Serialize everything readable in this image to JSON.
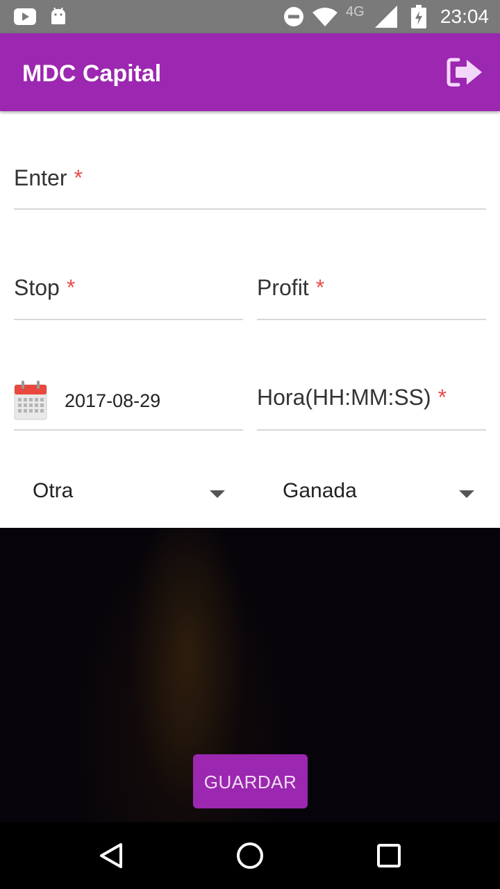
{
  "status_bar": {
    "time": "23:04",
    "network": "4G",
    "icons": [
      "youtube-icon",
      "android-icon",
      "do-not-disturb-icon",
      "wifi-icon",
      "signal-icon",
      "battery-icon"
    ]
  },
  "app_bar": {
    "title": "MDC Capital",
    "action_icon": "logout-icon"
  },
  "form": {
    "enter_label": "Enter",
    "stop_label": "Stop",
    "profit_label": "Profit",
    "required_mark": "*",
    "date_value": "2017-08-29",
    "time_label": "Hora(HH:MM:SS)",
    "type_select": "Otra",
    "result_select": "Ganada",
    "save_label": "GUARDAR"
  },
  "colors": {
    "primary": "#9c27b0",
    "required": "#e84c4c",
    "status_bar": "#7a7a7a"
  },
  "nav_bar": {
    "icons": [
      "back-icon",
      "home-icon",
      "recents-icon"
    ]
  }
}
